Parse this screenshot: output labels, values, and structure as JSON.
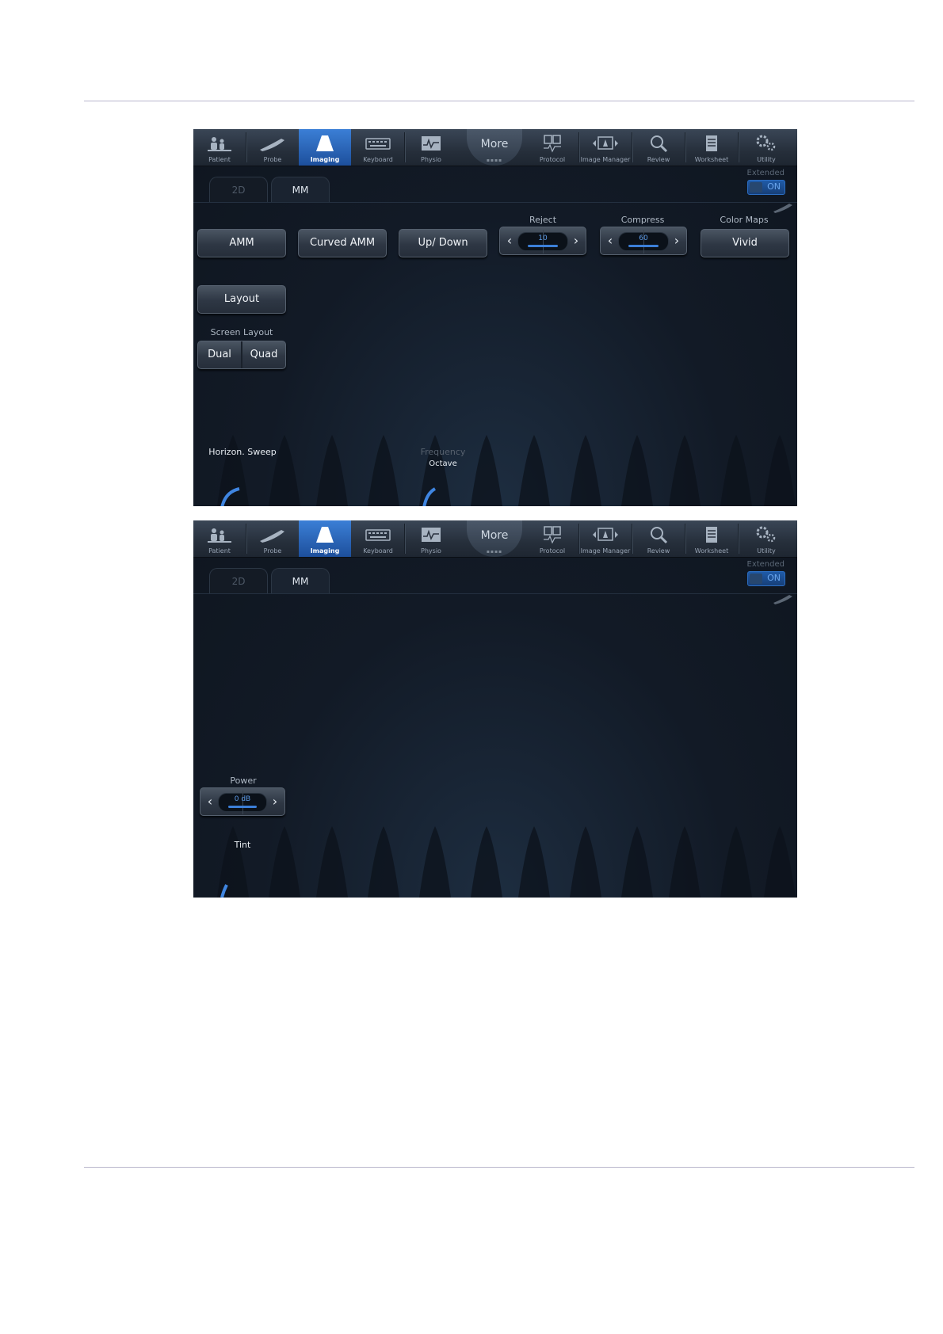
{
  "toolbar": {
    "items": [
      {
        "label": "Patient",
        "icon": "patient-icon"
      },
      {
        "label": "Probe",
        "icon": "probe-icon"
      },
      {
        "label": "Imaging",
        "icon": "imaging-icon",
        "active": true
      },
      {
        "label": "Keyboard",
        "icon": "keyboard-icon"
      },
      {
        "label": "Physio",
        "icon": "physio-icon"
      },
      {
        "label": "Protocol",
        "icon": "protocol-icon"
      },
      {
        "label": "Image Manager",
        "icon": "image-manager-icon"
      },
      {
        "label": "Review",
        "icon": "review-icon"
      },
      {
        "label": "Worksheet",
        "icon": "worksheet-icon"
      },
      {
        "label": "Utility",
        "icon": "utility-icon"
      }
    ],
    "more_label": "More"
  },
  "tabs": {
    "tab_2d": "2D",
    "tab_mm": "MM"
  },
  "extended": {
    "label": "Extended",
    "state": "ON"
  },
  "panel1": {
    "amm": "AMM",
    "curved_amm": "Curved AMM",
    "up_down": "Up/ Down",
    "reject": {
      "label": "Reject",
      "value": "10"
    },
    "compress": {
      "label": "Compress",
      "value": "60"
    },
    "color_maps": {
      "label": "Color Maps",
      "value": "Vivid"
    },
    "layout": "Layout",
    "screen_layout": {
      "label": "Screen Layout",
      "dual": "Dual",
      "quad": "Quad"
    },
    "horizon_sweep": "Horizon. Sweep",
    "frequency": {
      "label": "Frequency",
      "value": "Octave"
    }
  },
  "panel2": {
    "power": {
      "label": "Power",
      "value": "0 dB"
    },
    "tint": "Tint"
  },
  "colors": {
    "accent": "#3c7fd8",
    "panel_bg": "#121a26",
    "active_tab": "#2a6ac4"
  }
}
